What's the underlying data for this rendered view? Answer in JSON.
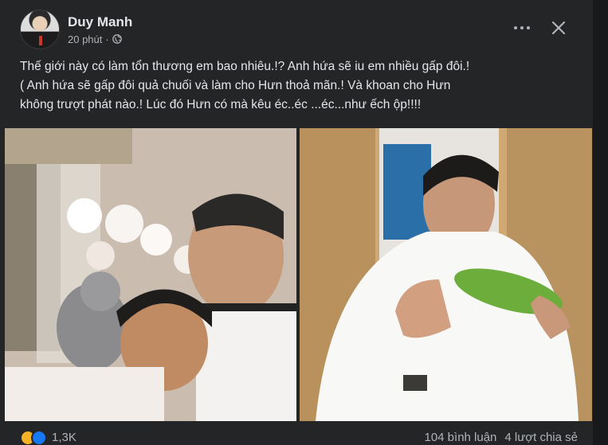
{
  "post": {
    "author": "Duy Manh",
    "time": "20 phút",
    "separator": "·",
    "text": "Thế giới này có làm tổn thương em bao nhiêu.!? Anh hứa sẽ iu em nhiều gấp đôi.!\n( Anh hứa sẽ gấp đôi quả chuối và làm cho Hưn thoả mãn.! Và khoan cho Hưn\nkhông trượt phát nào.! Lúc đó Hưn có mà kêu éc..éc ...éc...như ếch ộp!!!!",
    "icons": {
      "privacy": "globe-icon",
      "more": "more-icon",
      "close": "close-icon"
    }
  },
  "footer": {
    "reaction_count": "1,3K",
    "comments": "104 bình luận",
    "shares": "4 lượt chia sẻ",
    "reactions": [
      "haha-icon",
      "like-icon"
    ]
  },
  "colors": {
    "background": "#242526",
    "text": "#e4e6eb",
    "secondary_text": "#b0b3b8",
    "like": "#1877f2",
    "haha": "#f7b125"
  }
}
